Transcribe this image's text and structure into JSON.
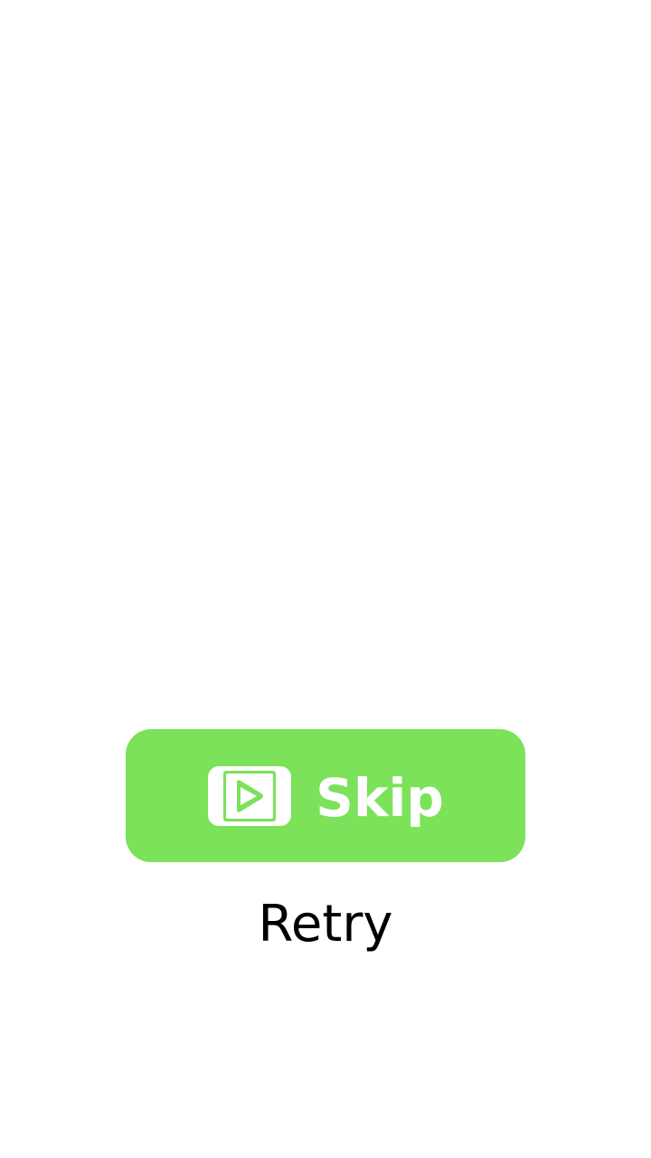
{
  "skip_button": {
    "label": "Skip",
    "icon": "video-play-icon",
    "background_color": "#7be25a",
    "text_color": "#ffffff"
  },
  "retry_link": {
    "label": "Retry",
    "text_color": "#000000"
  }
}
